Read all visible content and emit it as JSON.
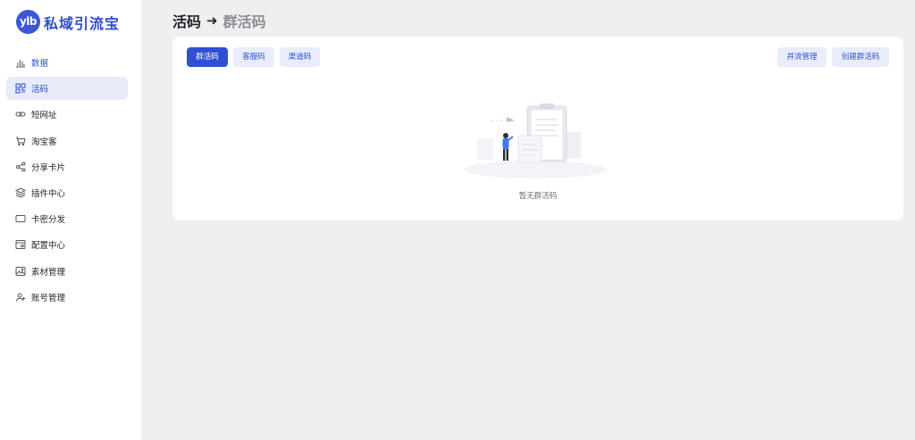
{
  "brand": {
    "badge": "ylb",
    "name": "私域引流宝"
  },
  "sidebar": {
    "items": [
      {
        "label": "数据",
        "icon": "bar-chart-icon"
      },
      {
        "label": "活码",
        "icon": "qrcode-icon"
      },
      {
        "label": "短网址",
        "icon": "link-icon"
      },
      {
        "label": "淘宝客",
        "icon": "cart-icon"
      },
      {
        "label": "分享卡片",
        "icon": "share-icon"
      },
      {
        "label": "插件中心",
        "icon": "layers-icon"
      },
      {
        "label": "卡密分发",
        "icon": "card-icon"
      },
      {
        "label": "配置中心",
        "icon": "settings-window-icon"
      },
      {
        "label": "素材管理",
        "icon": "image-icon"
      },
      {
        "label": "账号管理",
        "icon": "user-add-icon"
      }
    ]
  },
  "header": {
    "title": "活码",
    "arrow": "➜",
    "subtitle": "群活码"
  },
  "tabs": [
    {
      "label": "群活码"
    },
    {
      "label": "客服码"
    },
    {
      "label": "渠道码"
    }
  ],
  "actions": {
    "merge": "并流管理",
    "create": "创建群活码"
  },
  "empty": {
    "text": "暂无群活码"
  },
  "colors": {
    "accent": "#2f4fd5",
    "accent_light": "#e9ecfa",
    "active_nav_bg": "#e8ebf9"
  }
}
